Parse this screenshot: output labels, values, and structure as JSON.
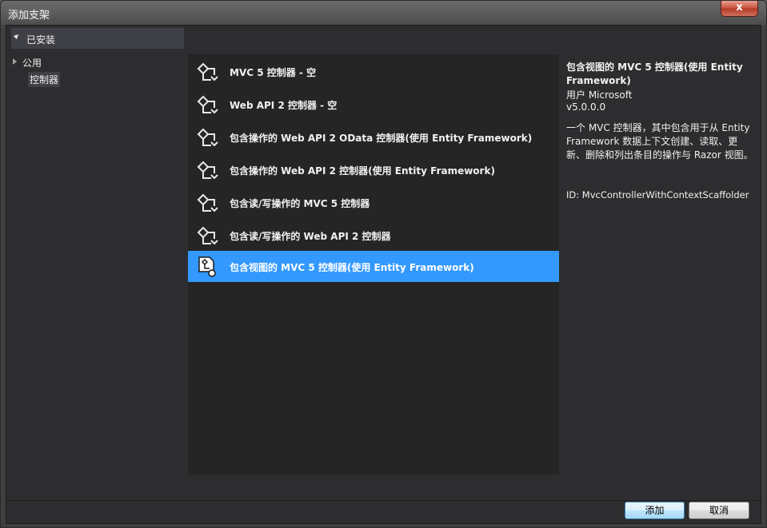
{
  "window": {
    "title": "添加支架",
    "close_label": "x"
  },
  "left_panel": {
    "installed_label": "已安装",
    "tree": [
      {
        "label": "公用"
      },
      {
        "label": "控制器"
      }
    ]
  },
  "templates": [
    {
      "label": "MVC 5 控制器 - 空",
      "icon": "controller-icon"
    },
    {
      "label": "Web API 2 控制器 - 空",
      "icon": "controller-icon"
    },
    {
      "label": "包含操作的 Web API 2 OData 控制器(使用 Entity Framework)",
      "icon": "controller-icon"
    },
    {
      "label": "包含操作的 Web API 2 控制器(使用 Entity Framework)",
      "icon": "controller-icon"
    },
    {
      "label": "包含读/写操作的 MVC 5 控制器",
      "icon": "controller-icon"
    },
    {
      "label": "包含读/写操作的 Web API 2 控制器",
      "icon": "controller-icon"
    },
    {
      "label": "包含视图的 MVC 5 控制器(使用 Entity Framework)",
      "icon": "controller-view-icon",
      "selected": true
    }
  ],
  "details": {
    "title": "包含视图的 MVC 5 控制器(使用 Entity Framework)",
    "vendor": "用户 Microsoft",
    "version": "v5.0.0.0",
    "description": "一个 MVC 控制器，其中包含用于从 Entity Framework 数据上下文创建、读取、更新、删除和列出条目的操作与 Razor 视图。",
    "id": "ID: MvcControllerWithContextScaffolder"
  },
  "buttons": {
    "add": "添加",
    "cancel": "取消"
  },
  "colors": {
    "selection": "#3399ff",
    "list_bg": "#252526",
    "panel_bg": "#2d2d30"
  }
}
